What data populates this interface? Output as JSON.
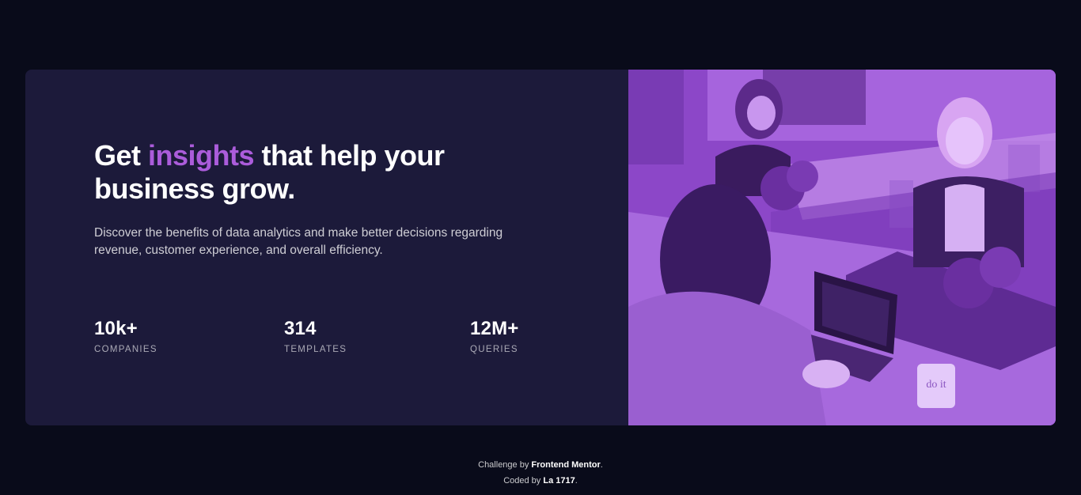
{
  "hero": {
    "heading_before": "Get ",
    "heading_accent": "insights",
    "heading_after": " that help your business grow.",
    "description": "Discover the benefits of data analytics and make better decisions regarding revenue, customer experience, and overall efficiency."
  },
  "stats": [
    {
      "value": "10k+",
      "label": "Companies"
    },
    {
      "value": "314",
      "label": "Templates"
    },
    {
      "value": "12M+",
      "label": "Queries"
    }
  ],
  "image": {
    "mug_text": "do it"
  },
  "footer": {
    "challenge_prefix": "Challenge by ",
    "challenge_name": "Frontend Mentor",
    "challenge_suffix": ".",
    "coded_prefix": "Coded by ",
    "coded_name": "La 1717",
    "coded_suffix": "."
  },
  "colors": {
    "page_background": "#090b1a",
    "card_background": "#1c1a3a",
    "accent": "#ab5cdb",
    "image_tint": "#8d46c9"
  }
}
